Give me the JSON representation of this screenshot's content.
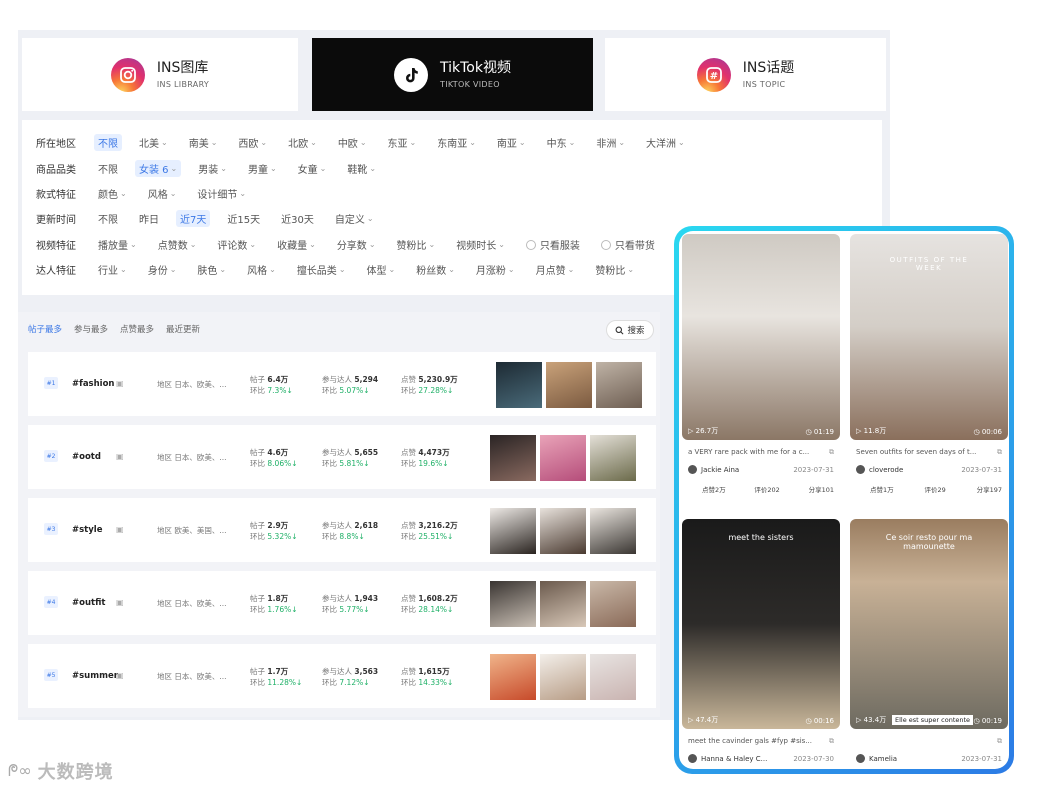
{
  "tabs": [
    {
      "title": "INS图库",
      "subtitle": "INS LIBRARY",
      "icon": "instagram-icon"
    },
    {
      "title": "TikTok视频",
      "subtitle": "TIKTOK VIDEO",
      "icon": "tiktok-icon"
    },
    {
      "title": "INS话题",
      "subtitle": "INS TOPIC",
      "icon": "hashtag-icon"
    }
  ],
  "filters": [
    {
      "label": "所在地区",
      "options": [
        {
          "t": "不限",
          "sel": true
        },
        {
          "t": "北美",
          "dd": true
        },
        {
          "t": "南美",
          "dd": true
        },
        {
          "t": "西欧",
          "dd": true
        },
        {
          "t": "北欧",
          "dd": true
        },
        {
          "t": "中欧",
          "dd": true
        },
        {
          "t": "东亚",
          "dd": true
        },
        {
          "t": "东南亚",
          "dd": true
        },
        {
          "t": "南亚",
          "dd": true
        },
        {
          "t": "中东",
          "dd": true
        },
        {
          "t": "非洲",
          "dd": true
        },
        {
          "t": "大洋洲",
          "dd": true
        }
      ]
    },
    {
      "label": "商品品类",
      "options": [
        {
          "t": "不限"
        },
        {
          "t": "女装 6",
          "sel": true,
          "dd": true
        },
        {
          "t": "男装",
          "dd": true
        },
        {
          "t": "男童",
          "dd": true
        },
        {
          "t": "女童",
          "dd": true
        },
        {
          "t": "鞋靴",
          "dd": true
        }
      ]
    },
    {
      "label": "款式特征",
      "options": [
        {
          "t": "颜色",
          "dd": true
        },
        {
          "t": "风格",
          "dd": true
        },
        {
          "t": "设计细节",
          "dd": true
        }
      ]
    },
    {
      "label": "更新时间",
      "options": [
        {
          "t": "不限"
        },
        {
          "t": "昨日"
        },
        {
          "t": "近7天",
          "sel": true
        },
        {
          "t": "近15天"
        },
        {
          "t": "近30天"
        },
        {
          "t": "自定义",
          "dd": true
        }
      ]
    },
    {
      "label": "视频特征",
      "options": [
        {
          "t": "播放量",
          "dd": true
        },
        {
          "t": "点赞数",
          "dd": true
        },
        {
          "t": "评论数",
          "dd": true
        },
        {
          "t": "收藏量",
          "dd": true
        },
        {
          "t": "分享数",
          "dd": true
        },
        {
          "t": "赞粉比",
          "dd": true
        },
        {
          "t": "视频时长",
          "dd": true
        },
        {
          "t": "只看服装",
          "chk": true
        },
        {
          "t": "只看带货",
          "chk": true
        }
      ]
    },
    {
      "label": "达人特征",
      "options": [
        {
          "t": "行业",
          "dd": true
        },
        {
          "t": "身份",
          "dd": true
        },
        {
          "t": "肤色",
          "dd": true
        },
        {
          "t": "风格",
          "dd": true
        },
        {
          "t": "擅长品类",
          "dd": true
        },
        {
          "t": "体型",
          "dd": true
        },
        {
          "t": "粉丝数",
          "dd": true
        },
        {
          "t": "月涨粉",
          "dd": true
        },
        {
          "t": "月点赞",
          "dd": true
        },
        {
          "t": "赞粉比",
          "dd": true
        }
      ]
    }
  ],
  "sort": {
    "items": [
      "帖子最多",
      "参与最多",
      "点赞最多",
      "最近更新"
    ],
    "search": "搜索"
  },
  "topics": [
    {
      "rank": "#1",
      "tag": "#fashion",
      "region": "地区 日本、欧美、...",
      "posts": "6.4万",
      "posts_r": "7.3%↓",
      "people": "5,294",
      "people_r": "5.07%↓",
      "likes": "5,230.9万",
      "likes_r": "27.28%↓"
    },
    {
      "rank": "#2",
      "tag": "#ootd",
      "region": "地区 日本、欧美、...",
      "posts": "4.6万",
      "posts_r": "8.06%↓",
      "people": "5,655",
      "people_r": "5.81%↓",
      "likes": "4,473万",
      "likes_r": "19.6%↓"
    },
    {
      "rank": "#3",
      "tag": "#style",
      "region": "地区 欧美、美国、...",
      "posts": "2.9万",
      "posts_r": "5.32%↓",
      "people": "2,618",
      "people_r": "8.8%↓",
      "likes": "3,216.2万",
      "likes_r": "25.51%↓"
    },
    {
      "rank": "#4",
      "tag": "#outfit",
      "region": "地区 日本、欧美、...",
      "posts": "1.8万",
      "posts_r": "1.76%↓",
      "people": "1,943",
      "people_r": "5.77%↓",
      "likes": "1,608.2万",
      "likes_r": "28.14%↓"
    },
    {
      "rank": "#5",
      "tag": "#summer",
      "region": "地区 日本、欧美、...",
      "posts": "1.7万",
      "posts_r": "11.28%↓",
      "people": "3,563",
      "people_r": "7.12%↓",
      "likes": "1,615万",
      "likes_r": "14.33%↓"
    }
  ],
  "metric_labels": {
    "posts": "帖子",
    "people": "参与达人",
    "likes": "点赞",
    "ratio": "环比"
  },
  "videos": [
    {
      "overlay": "",
      "views": "26.7万",
      "dur": "01:19",
      "title": "a VERY rare pack with me for a c...",
      "author": "Jackie Aina",
      "date": "2023-07-31",
      "likes": "点赞2万",
      "comments": "评价202",
      "shares": "分享101"
    },
    {
      "overlay": "OUTFITS OF THE WEEK",
      "views": "11.8万",
      "dur": "00:06",
      "title": "Seven outfits for seven days of t...",
      "author": "cloverode",
      "date": "2023-07-31",
      "likes": "点赞1万",
      "comments": "评价29",
      "shares": "分享197"
    },
    {
      "overlay": "meet the sisters",
      "views": "47.4万",
      "dur": "00:16",
      "title": "meet the cavinder gals #fyp #sis...",
      "author": "Hanna & Haley C...",
      "date": "2023-07-30"
    },
    {
      "overlay": "Ce soir resto pour ma mamounette",
      "caption": "Elle est super contente",
      "views": "43.4万",
      "dur": "00:19",
      "title": "",
      "author": "Kamelia",
      "date": "2023-07-31"
    }
  ],
  "watermark": "大数跨境",
  "colors": {
    "accent": "#3c78e6",
    "green": "#1fb067",
    "card_border_from": "#2ad8f0",
    "card_border_to": "#2c7be5"
  }
}
